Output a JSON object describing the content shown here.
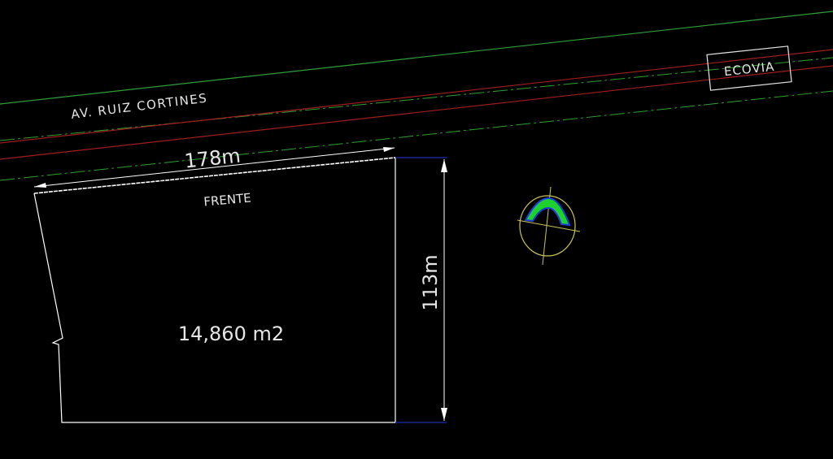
{
  "drawing": {
    "road_label": "AV. RUIZ CORTINES",
    "ecovia_label": "ECOVIA",
    "front_label": "FRENTE",
    "area_label": "14,860  m2",
    "dim_width_label": "178m",
    "dim_height_label": "113m"
  },
  "colors": {
    "background": "#000000",
    "green_line": "#2e9e3a",
    "red_line": "#a11d1d",
    "green_dashdot": "#2fa02f",
    "lot_outline": "#ffffff",
    "dimension": "#ffffff",
    "dimension_tick": "#1c2fb0",
    "north_circle": "#c9c35a",
    "north_fill": "#1fd12f",
    "north_fill_edge": "#1a3fd9"
  },
  "icons": {
    "north_arrow": "north-arrow-icon"
  }
}
